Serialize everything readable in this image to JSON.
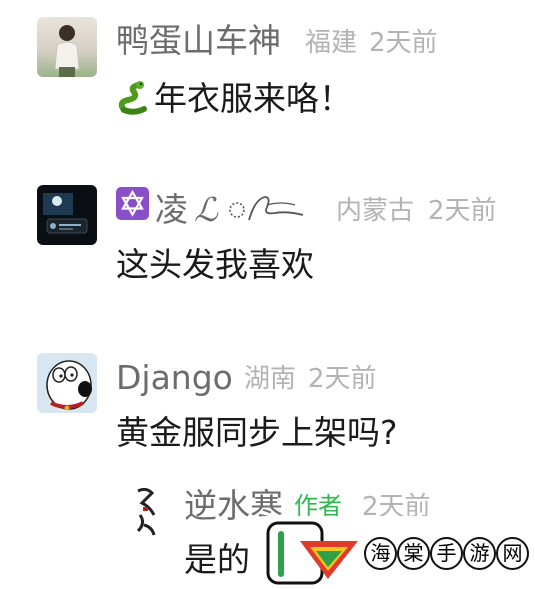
{
  "comments": [
    {
      "username": "鸭蛋山车神",
      "location": "福建",
      "time": "2天前",
      "content": "年衣服来咯！",
      "content_prefix_icon": "snake-emoji-icon"
    },
    {
      "username_prefix_icon": "star-of-david-emoji-icon",
      "username": "凌",
      "username_suffix": "ℒ",
      "location": "内蒙古",
      "time": "2天前",
      "content": "这头发我喜欢"
    },
    {
      "username": "Django",
      "location": "湖南",
      "time": "2天前",
      "content": "黄金服同步上架吗?"
    }
  ],
  "reply": {
    "username": "逆水寒",
    "badge": "作者",
    "time": "2天前",
    "content": "是的"
  },
  "colors": {
    "name": "#6c6c6c",
    "meta": "#b3b3b3",
    "text": "#1a1a1a",
    "author_badge": "#2fb84f"
  },
  "watermark": {
    "chars": [
      "海",
      "棠",
      "手",
      "游",
      "网"
    ]
  }
}
